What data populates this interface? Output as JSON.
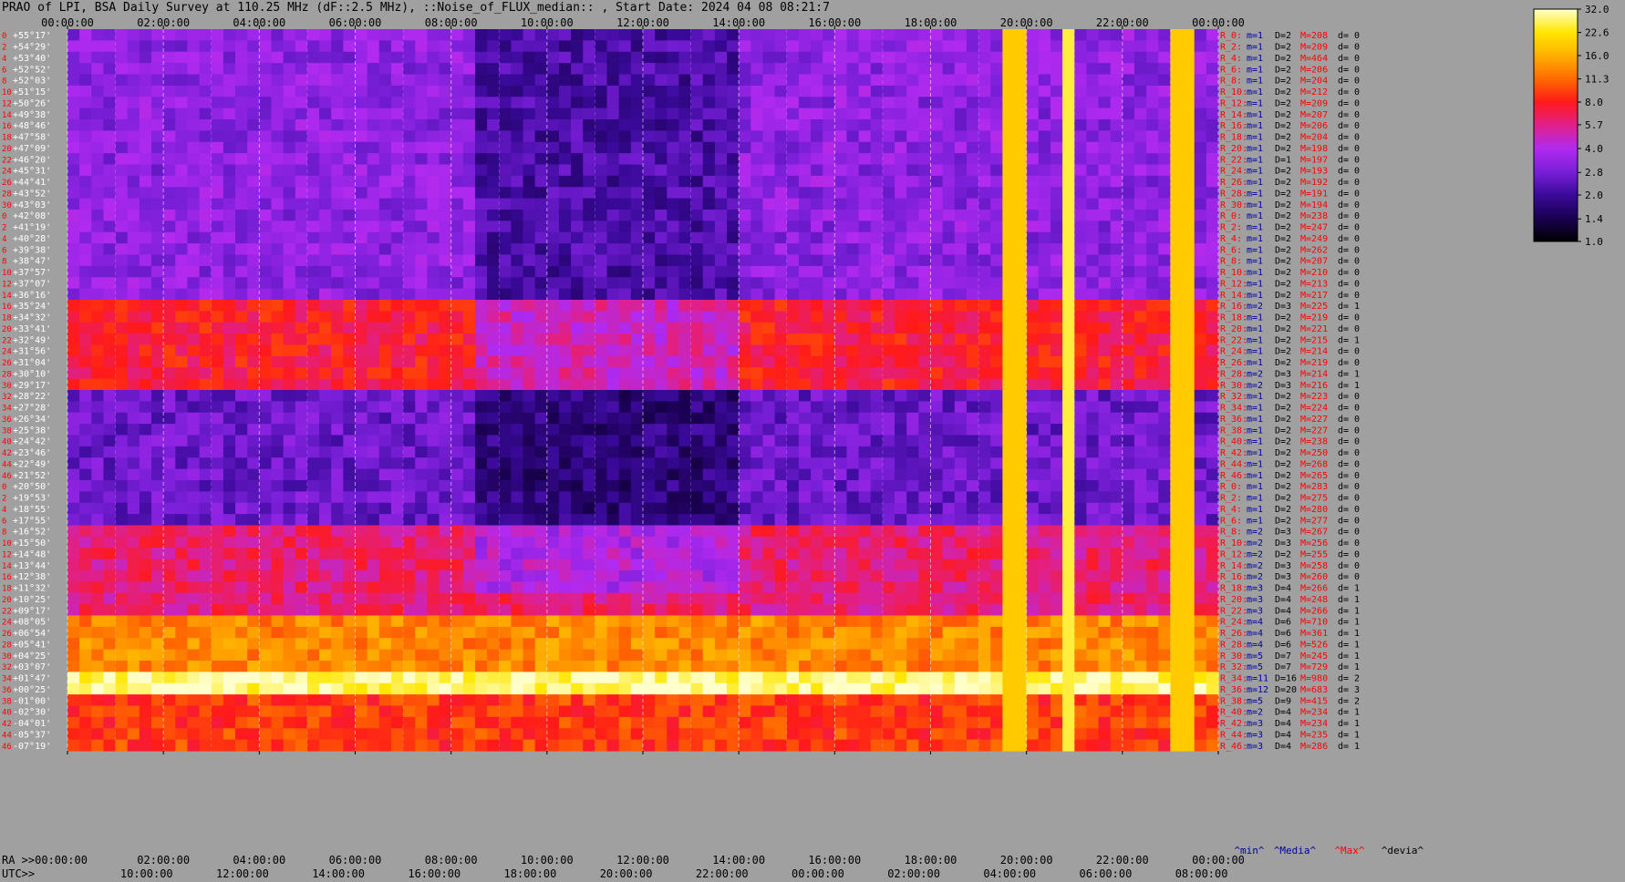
{
  "title": "PRAO of LPI, BSA Daily Survey at 110.25 MHz (dF::2.5 MHz), ::Noise_of_FLUX_median:: , Start Date: 2024 04 08 08:21:7",
  "chart_data": {
    "type": "heatmap",
    "ra_ticks_top": [
      "00:00:00",
      "02:00:00",
      "04:00:00",
      "06:00:00",
      "08:00:00",
      "10:00:00",
      "12:00:00",
      "14:00:00",
      "16:00:00",
      "18:00:00",
      "20:00:00",
      "22:00:00",
      "00:00:00"
    ],
    "ra_ticks_bottom": [
      "RA >>00:00:00",
      "02:00:00",
      "04:00:00",
      "06:00:00",
      "08:00:00",
      "10:00:00",
      "12:00:00",
      "14:00:00",
      "16:00:00",
      "18:00:00",
      "20:00:00",
      "22:00:00",
      "00:00:00"
    ],
    "utc_label": "UTC>>",
    "utc_ticks": [
      "10:00:00",
      "12:00:00",
      "14:00:00",
      "16:00:00",
      "18:00:00",
      "20:00:00",
      "22:00:00",
      "00:00:00",
      "02:00:00",
      "04:00:00",
      "06:00:00",
      "08:00:00"
    ],
    "dec_labels": [
      "+55°17'",
      "+54°29'",
      "+53°40'",
      "+52°52'",
      "+52°03'",
      "+51°15'",
      "+50°26'",
      "+49°38'",
      "+48°46'",
      "+47°58'",
      "+47°09'",
      "+46°20'",
      "+45°31'",
      "+44°41'",
      "+43°52'",
      "+43°03'",
      "+42°08'",
      "+41°19'",
      "+40°28'",
      "+39°38'",
      "+38°47'",
      "+37°57'",
      "+37°07'",
      "+36°16'",
      "+35°24'",
      "+34°32'",
      "+33°41'",
      "+32°49'",
      "+31°56'",
      "+31°04'",
      "+30°10'",
      "+29°17'",
      "+28°22'",
      "+27°28'",
      "+26°34'",
      "+25°38'",
      "+24°42'",
      "+23°46'",
      "+22°49'",
      "+21°52'",
      "+20°50'",
      "+19°53'",
      "+18°55'",
      "+17°55'",
      "+16°52'",
      "+15°50'",
      "+14°48'",
      "+13°44'",
      "+12°38'",
      "+11°32'",
      "+10°25'",
      "+09°17'",
      "+08°05'",
      "+06°54'",
      "+05°41'",
      "+04°25'",
      "+03°07'",
      "+01°47'",
      "+00°25'",
      "-01°00'",
      "-02°30'",
      "-04°01'",
      "-05°37'",
      "-07°19'"
    ],
    "beam_index": [
      "0",
      "2",
      "4",
      "6",
      "8",
      "10",
      "12",
      "14",
      "16",
      "18",
      "20",
      "22",
      "24",
      "26",
      "28",
      "30",
      "0",
      "2",
      "4",
      "6",
      "8",
      "10",
      "12",
      "14",
      "16",
      "18",
      "20",
      "22",
      "24",
      "26",
      "28",
      "30",
      "32",
      "34",
      "36",
      "38",
      "40",
      "42",
      "44",
      "46",
      "0",
      "2",
      "4",
      "6",
      "8",
      "10",
      "12",
      "14",
      "16",
      "18",
      "20",
      "22",
      "24",
      "26",
      "28",
      "30",
      "32",
      "34",
      "36",
      "38",
      "40",
      "42",
      "44",
      "46"
    ],
    "stats": [
      {
        "r": "R_0:",
        "m": "m=1",
        "D": "D=2",
        "M": "M=208",
        "d": "d= 0"
      },
      {
        "r": "R_2:",
        "m": "m=1",
        "D": "D=2",
        "M": "M=209",
        "d": "d= 0"
      },
      {
        "r": "R_4:",
        "m": "m=1",
        "D": "D=2",
        "M": "M=464",
        "d": "d= 0"
      },
      {
        "r": "R_6:",
        "m": "m=1",
        "D": "D=2",
        "M": "M=206",
        "d": "d= 0"
      },
      {
        "r": "R_8:",
        "m": "m=1",
        "D": "D=2",
        "M": "M=204",
        "d": "d= 0"
      },
      {
        "r": "R_10:",
        "m": "m=1",
        "D": "D=2",
        "M": "M=212",
        "d": "d= 0"
      },
      {
        "r": "R_12:",
        "m": "m=1",
        "D": "D=2",
        "M": "M=209",
        "d": "d= 0"
      },
      {
        "r": "R_14:",
        "m": "m=1",
        "D": "D=2",
        "M": "M=207",
        "d": "d= 0"
      },
      {
        "r": "R_16:",
        "m": "m=1",
        "D": "D=2",
        "M": "M=206",
        "d": "d= 0"
      },
      {
        "r": "R_18:",
        "m": "m=1",
        "D": "D=2",
        "M": "M=204",
        "d": "d= 0"
      },
      {
        "r": "R_20:",
        "m": "m=1",
        "D": "D=2",
        "M": "M=198",
        "d": "d= 0"
      },
      {
        "r": "R_22:",
        "m": "m=1",
        "D": "D=1",
        "M": "M=197",
        "d": "d= 0"
      },
      {
        "r": "R_24:",
        "m": "m=1",
        "D": "D=2",
        "M": "M=193",
        "d": "d= 0"
      },
      {
        "r": "R_26:",
        "m": "m=1",
        "D": "D=2",
        "M": "M=192",
        "d": "d= 0"
      },
      {
        "r": "R_28:",
        "m": "m=1",
        "D": "D=2",
        "M": "M=191",
        "d": "d= 0"
      },
      {
        "r": "R_30:",
        "m": "m=1",
        "D": "D=2",
        "M": "M=194",
        "d": "d= 0"
      },
      {
        "r": "R_0:",
        "m": "m=1",
        "D": "D=2",
        "M": "M=238",
        "d": "d= 0"
      },
      {
        "r": "R_2:",
        "m": "m=1",
        "D": "D=2",
        "M": "M=247",
        "d": "d= 0"
      },
      {
        "r": "R_4:",
        "m": "m=1",
        "D": "D=2",
        "M": "M=249",
        "d": "d= 0"
      },
      {
        "r": "R_6:",
        "m": "m=1",
        "D": "D=2",
        "M": "M=262",
        "d": "d= 0"
      },
      {
        "r": "R_8:",
        "m": "m=1",
        "D": "D=2",
        "M": "M=207",
        "d": "d= 0"
      },
      {
        "r": "R_10:",
        "m": "m=1",
        "D": "D=2",
        "M": "M=210",
        "d": "d= 0"
      },
      {
        "r": "R_12:",
        "m": "m=1",
        "D": "D=2",
        "M": "M=213",
        "d": "d= 0"
      },
      {
        "r": "R_14:",
        "m": "m=1",
        "D": "D=2",
        "M": "M=217",
        "d": "d= 0"
      },
      {
        "r": "R_16:",
        "m": "m=2",
        "D": "D=3",
        "M": "M=225",
        "d": "d= 1"
      },
      {
        "r": "R_18:",
        "m": "m=1",
        "D": "D=2",
        "M": "M=219",
        "d": "d= 0"
      },
      {
        "r": "R_20:",
        "m": "m=1",
        "D": "D=2",
        "M": "M=221",
        "d": "d= 0"
      },
      {
        "r": "R_22:",
        "m": "m=1",
        "D": "D=2",
        "M": "M=215",
        "d": "d= 1"
      },
      {
        "r": "R_24:",
        "m": "m=1",
        "D": "D=2",
        "M": "M=214",
        "d": "d= 0"
      },
      {
        "r": "R_26:",
        "m": "m=1",
        "D": "D=2",
        "M": "M=219",
        "d": "d= 0"
      },
      {
        "r": "R_28:",
        "m": "m=2",
        "D": "D=3",
        "M": "M=214",
        "d": "d= 1"
      },
      {
        "r": "R_30:",
        "m": "m=2",
        "D": "D=3",
        "M": "M=216",
        "d": "d= 1"
      },
      {
        "r": "R_32:",
        "m": "m=1",
        "D": "D=2",
        "M": "M=223",
        "d": "d= 0"
      },
      {
        "r": "R_34:",
        "m": "m=1",
        "D": "D=2",
        "M": "M=224",
        "d": "d= 0"
      },
      {
        "r": "R_36:",
        "m": "m=1",
        "D": "D=2",
        "M": "M=227",
        "d": "d= 0"
      },
      {
        "r": "R_38:",
        "m": "m=1",
        "D": "D=2",
        "M": "M=227",
        "d": "d= 0"
      },
      {
        "r": "R_40:",
        "m": "m=1",
        "D": "D=2",
        "M": "M=238",
        "d": "d= 0"
      },
      {
        "r": "R_42:",
        "m": "m=1",
        "D": "D=2",
        "M": "M=250",
        "d": "d= 0"
      },
      {
        "r": "R_44:",
        "m": "m=1",
        "D": "D=2",
        "M": "M=268",
        "d": "d= 0"
      },
      {
        "r": "R_46:",
        "m": "m=1",
        "D": "D=2",
        "M": "M=265",
        "d": "d= 0"
      },
      {
        "r": "R_0:",
        "m": "m=1",
        "D": "D=2",
        "M": "M=283",
        "d": "d= 0"
      },
      {
        "r": "R_2:",
        "m": "m=1",
        "D": "D=2",
        "M": "M=275",
        "d": "d= 0"
      },
      {
        "r": "R_4:",
        "m": "m=1",
        "D": "D=2",
        "M": "M=280",
        "d": "d= 0"
      },
      {
        "r": "R_6:",
        "m": "m=1",
        "D": "D=2",
        "M": "M=277",
        "d": "d= 0"
      },
      {
        "r": "R_8:",
        "m": "m=2",
        "D": "D=3",
        "M": "M=267",
        "d": "d= 0"
      },
      {
        "r": "R_10:",
        "m": "m=2",
        "D": "D=3",
        "M": "M=256",
        "d": "d= 0"
      },
      {
        "r": "R_12:",
        "m": "m=2",
        "D": "D=2",
        "M": "M=255",
        "d": "d= 0"
      },
      {
        "r": "R_14:",
        "m": "m=2",
        "D": "D=3",
        "M": "M=258",
        "d": "d= 0"
      },
      {
        "r": "R_16:",
        "m": "m=2",
        "D": "D=3",
        "M": "M=260",
        "d": "d= 0"
      },
      {
        "r": "R_18:",
        "m": "m=3",
        "D": "D=4",
        "M": "M=266",
        "d": "d= 1"
      },
      {
        "r": "R_20:",
        "m": "m=3",
        "D": "D=4",
        "M": "M=248",
        "d": "d= 1"
      },
      {
        "r": "R_22:",
        "m": "m=3",
        "D": "D=4",
        "M": "M=266",
        "d": "d= 1"
      },
      {
        "r": "R_24:",
        "m": "m=4",
        "D": "D=6",
        "M": "M=710",
        "d": "d= 1"
      },
      {
        "r": "R_26:",
        "m": "m=4",
        "D": "D=6",
        "M": "M=361",
        "d": "d= 1"
      },
      {
        "r": "R_28:",
        "m": "m=4",
        "D": "D=6",
        "M": "M=526",
        "d": "d= 1"
      },
      {
        "r": "R_30:",
        "m": "m=5",
        "D": "D=7",
        "M": "M=245",
        "d": "d= 1"
      },
      {
        "r": "R_32:",
        "m": "m=5",
        "D": "D=7",
        "M": "M=729",
        "d": "d= 1"
      },
      {
        "r": "R_34:",
        "m": "m=11",
        "D": "D=16",
        "M": "M=980",
        "d": "d= 2"
      },
      {
        "r": "R_36:",
        "m": "m=12",
        "D": "D=20",
        "M": "M=683",
        "d": "d= 3"
      },
      {
        "r": "R_38:",
        "m": "m=5",
        "D": "D=9",
        "M": "M=415",
        "d": "d= 2"
      },
      {
        "r": "R_40:",
        "m": "m=2",
        "D": "D=4",
        "M": "M=234",
        "d": "d= 1"
      },
      {
        "r": "R_42:",
        "m": "m=3",
        "D": "D=4",
        "M": "M=234",
        "d": "d= 1"
      },
      {
        "r": "R_44:",
        "m": "m=3",
        "D": "D=4",
        "M": "M=235",
        "d": "d= 1"
      },
      {
        "r": "R_46:",
        "m": "m=3",
        "D": "D=4",
        "M": "M=286",
        "d": "d= 1"
      }
    ],
    "stats_footer": [
      "^min^",
      "^Media^",
      "^Max^",
      "^devia^"
    ],
    "colorbar_ticks": [
      "32.0",
      "22.6",
      "16.0",
      "11.3",
      "8.0",
      "5.7",
      "4.0",
      "2.8",
      "2.0",
      "1.4",
      "1.0"
    ],
    "colorbar_range": [
      1.0,
      32.0
    ],
    "colorbar_scale": "log2",
    "colormap": [
      "#000000",
      "#1a0050",
      "#3a0a9a",
      "#7a1fd8",
      "#b02af0",
      "#e0208a",
      "#ff1a1a",
      "#ff6a00",
      "#ffb000",
      "#ffe600",
      "#ffffcc"
    ],
    "colors": {
      "background": "#a0a0a0",
      "stat_blue": "#0000a0",
      "stat_red": "#ff0000",
      "stat_black": "#000000",
      "dec_label": "#ffffff",
      "beam_index": "#ff0000"
    }
  }
}
